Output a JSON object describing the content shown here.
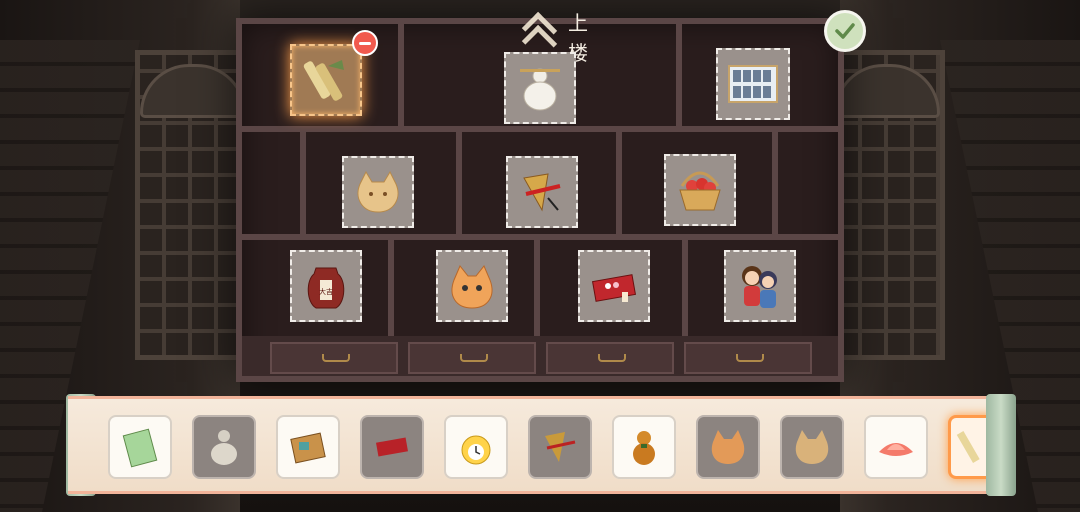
{
  "header": {
    "up_floor_label": "上楼"
  },
  "cabinet_items": [
    {
      "name": "bamboo-scroll",
      "state": "selected"
    },
    {
      "name": "gourd-vase",
      "state": "placed"
    },
    {
      "name": "idol-photo-board",
      "state": "placed"
    },
    {
      "name": "lucky-cat-cookie",
      "state": "placed"
    },
    {
      "name": "fan-ornament",
      "state": "placed"
    },
    {
      "name": "apple-basket",
      "state": "placed"
    },
    {
      "name": "wine-jar",
      "label": "大吉",
      "state": "placed"
    },
    {
      "name": "cat-cushion",
      "state": "placed"
    },
    {
      "name": "red-gift-box",
      "state": "placed"
    },
    {
      "name": "chibi-couple-figures",
      "state": "placed"
    }
  ],
  "inventory": [
    {
      "name": "green-ticket",
      "state": "available"
    },
    {
      "name": "gourd-vase",
      "state": "used"
    },
    {
      "name": "wooden-toolbox",
      "state": "available"
    },
    {
      "name": "red-gift-box",
      "state": "used"
    },
    {
      "name": "chick-clock",
      "state": "available"
    },
    {
      "name": "fan-ornament",
      "state": "used"
    },
    {
      "name": "calabash-gourd",
      "state": "available"
    },
    {
      "name": "cat-cushion",
      "state": "used"
    },
    {
      "name": "lucky-cat-cookie",
      "state": "used"
    },
    {
      "name": "lotus-lamp",
      "state": "available"
    },
    {
      "name": "bamboo-scroll",
      "state": "selected"
    }
  ],
  "colors": {
    "accent_orange": "#ff9a4a",
    "remove_red": "#f15a4e",
    "confirm_green": "#cfe1bd",
    "cabinet_wood": "#2a1d1d"
  },
  "icons": {
    "confirm": "checkmark-icon",
    "remove": "minus-icon",
    "up": "double-chevron-up-icon"
  }
}
